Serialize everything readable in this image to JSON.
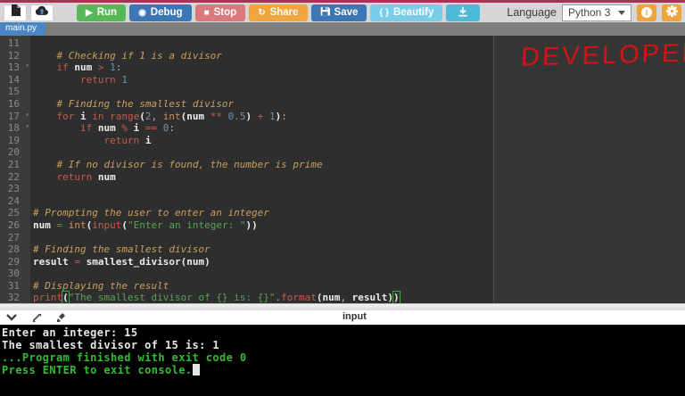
{
  "toolbar": {
    "run_label": "Run",
    "debug_label": "Debug",
    "stop_label": "Stop",
    "share_label": "Share",
    "save_label": "Save",
    "beautify_label": "Beautify",
    "language_label": "Language",
    "language_value": "Python 3",
    "icons": {
      "run_glyph": "▶",
      "debug_glyph": "◉",
      "stop_glyph": "■",
      "share_glyph": "↻",
      "beautify_glyph": "{ }",
      "info_glyph": "i"
    }
  },
  "tab": {
    "name": "main.py"
  },
  "editor": {
    "watermark": "DEVELOPER",
    "lines": [
      {
        "n": 11,
        "t": []
      },
      {
        "n": 12,
        "t": [
          [
            "p",
            "    "
          ],
          [
            "c",
            "# Checking if 1 is a divisor"
          ]
        ]
      },
      {
        "n": 13,
        "fold": true,
        "t": [
          [
            "p",
            "    "
          ],
          [
            "k",
            "if"
          ],
          [
            "p",
            " "
          ],
          [
            "w",
            "num"
          ],
          [
            "p",
            " "
          ],
          [
            "k",
            ">"
          ],
          [
            "p",
            " "
          ],
          [
            "n",
            "1"
          ],
          [
            "p",
            ":"
          ]
        ]
      },
      {
        "n": 14,
        "t": [
          [
            "p",
            "        "
          ],
          [
            "k",
            "return"
          ],
          [
            "p",
            " "
          ],
          [
            "n",
            "1"
          ]
        ]
      },
      {
        "n": 15,
        "t": []
      },
      {
        "n": 16,
        "t": [
          [
            "p",
            "    "
          ],
          [
            "c",
            "# Finding the smallest divisor"
          ]
        ]
      },
      {
        "n": 17,
        "fold": true,
        "t": [
          [
            "p",
            "    "
          ],
          [
            "k",
            "for"
          ],
          [
            "p",
            " "
          ],
          [
            "w",
            "i"
          ],
          [
            "p",
            " "
          ],
          [
            "k",
            "in"
          ],
          [
            "p",
            " "
          ],
          [
            "k",
            "range"
          ],
          [
            "w",
            "("
          ],
          [
            "n",
            "2"
          ],
          [
            "p",
            ", "
          ],
          [
            "b",
            "int"
          ],
          [
            "w",
            "("
          ],
          [
            "w",
            "num"
          ],
          [
            "p",
            " "
          ],
          [
            "k",
            "**"
          ],
          [
            "p",
            " "
          ],
          [
            "n",
            "0.5"
          ],
          [
            "w",
            ")"
          ],
          [
            "p",
            " "
          ],
          [
            "k",
            "+"
          ],
          [
            "p",
            " "
          ],
          [
            "n",
            "1"
          ],
          [
            "w",
            ")"
          ],
          [
            "p",
            ":"
          ]
        ]
      },
      {
        "n": 18,
        "fold": true,
        "t": [
          [
            "p",
            "        "
          ],
          [
            "k",
            "if"
          ],
          [
            "p",
            " "
          ],
          [
            "w",
            "num"
          ],
          [
            "p",
            " "
          ],
          [
            "k",
            "%"
          ],
          [
            "p",
            " "
          ],
          [
            "w",
            "i"
          ],
          [
            "p",
            " "
          ],
          [
            "k",
            "=="
          ],
          [
            "p",
            " "
          ],
          [
            "n",
            "0"
          ],
          [
            "p",
            ":"
          ]
        ]
      },
      {
        "n": 19,
        "t": [
          [
            "p",
            "            "
          ],
          [
            "k",
            "return"
          ],
          [
            "p",
            " "
          ],
          [
            "w",
            "i"
          ]
        ]
      },
      {
        "n": 20,
        "t": []
      },
      {
        "n": 21,
        "t": [
          [
            "p",
            "    "
          ],
          [
            "c",
            "# If no divisor is found, the number is prime"
          ]
        ]
      },
      {
        "n": 22,
        "t": [
          [
            "p",
            "    "
          ],
          [
            "k",
            "return"
          ],
          [
            "p",
            " "
          ],
          [
            "w",
            "num"
          ]
        ]
      },
      {
        "n": 23,
        "t": []
      },
      {
        "n": 24,
        "t": []
      },
      {
        "n": 25,
        "t": [
          [
            "c",
            "# Prompting the user to enter an integer"
          ]
        ]
      },
      {
        "n": 26,
        "t": [
          [
            "w",
            "num"
          ],
          [
            "p",
            " "
          ],
          [
            "k",
            "="
          ],
          [
            "p",
            " "
          ],
          [
            "b",
            "int"
          ],
          [
            "w",
            "("
          ],
          [
            "k",
            "input"
          ],
          [
            "w",
            "("
          ],
          [
            "s",
            "\"Enter an integer: \""
          ],
          [
            "w",
            "))"
          ]
        ]
      },
      {
        "n": 27,
        "t": []
      },
      {
        "n": 28,
        "t": [
          [
            "c",
            "# Finding the smallest divisor"
          ]
        ]
      },
      {
        "n": 29,
        "t": [
          [
            "w",
            "result"
          ],
          [
            "p",
            " "
          ],
          [
            "k",
            "="
          ],
          [
            "p",
            " "
          ],
          [
            "w",
            "smallest_divisor"
          ],
          [
            "w",
            "("
          ],
          [
            "w",
            "num"
          ],
          [
            "w",
            ")"
          ]
        ]
      },
      {
        "n": 30,
        "t": []
      },
      {
        "n": 31,
        "t": [
          [
            "c",
            "# Displaying the result"
          ]
        ]
      },
      {
        "n": 32,
        "caret": true,
        "t": [
          [
            "k",
            "print"
          ],
          [
            "g",
            "("
          ],
          [
            "s",
            "\"The smallest divisor of {} is: {}\""
          ],
          [
            "p",
            "."
          ],
          [
            "k",
            "format"
          ],
          [
            "w",
            "("
          ],
          [
            "w",
            "num"
          ],
          [
            "p",
            ", "
          ],
          [
            "w",
            "result"
          ],
          [
            "w",
            ")"
          ],
          [
            "g",
            ")"
          ]
        ]
      }
    ]
  },
  "input_bar": {
    "label": "input"
  },
  "console": {
    "lines": [
      {
        "cls": "out",
        "text": "Enter an integer: 15"
      },
      {
        "cls": "out",
        "text": "The smallest divisor of 15 is: 1"
      },
      {
        "cls": "out",
        "text": ""
      },
      {
        "cls": "out",
        "text": ""
      },
      {
        "cls": "ok",
        "text": "...Program finished with exit code 0"
      },
      {
        "cls": "ok",
        "text": "Press ENTER to exit console.",
        "cursor": true
      }
    ]
  },
  "colors": {
    "top_line": "#a93355",
    "run_green": "#57b857",
    "debug_blue": "#3d76b5",
    "stop_red": "#d9797e",
    "share_orange": "#f0a53e",
    "beautify_cyan": "#79cde8",
    "settings_orange": "#efa33d",
    "tab_blue": "#4a86c4",
    "editor_bg": "#2e2e2e",
    "gutter_bg": "#3b3b3b",
    "comment": "#c9a05f",
    "keyword": "#c75b4e",
    "builtin": "#d2915c",
    "number": "#6a93b5",
    "string": "#55a555",
    "console_green": "#2fbe2f",
    "watermark_red": "#d41414"
  }
}
